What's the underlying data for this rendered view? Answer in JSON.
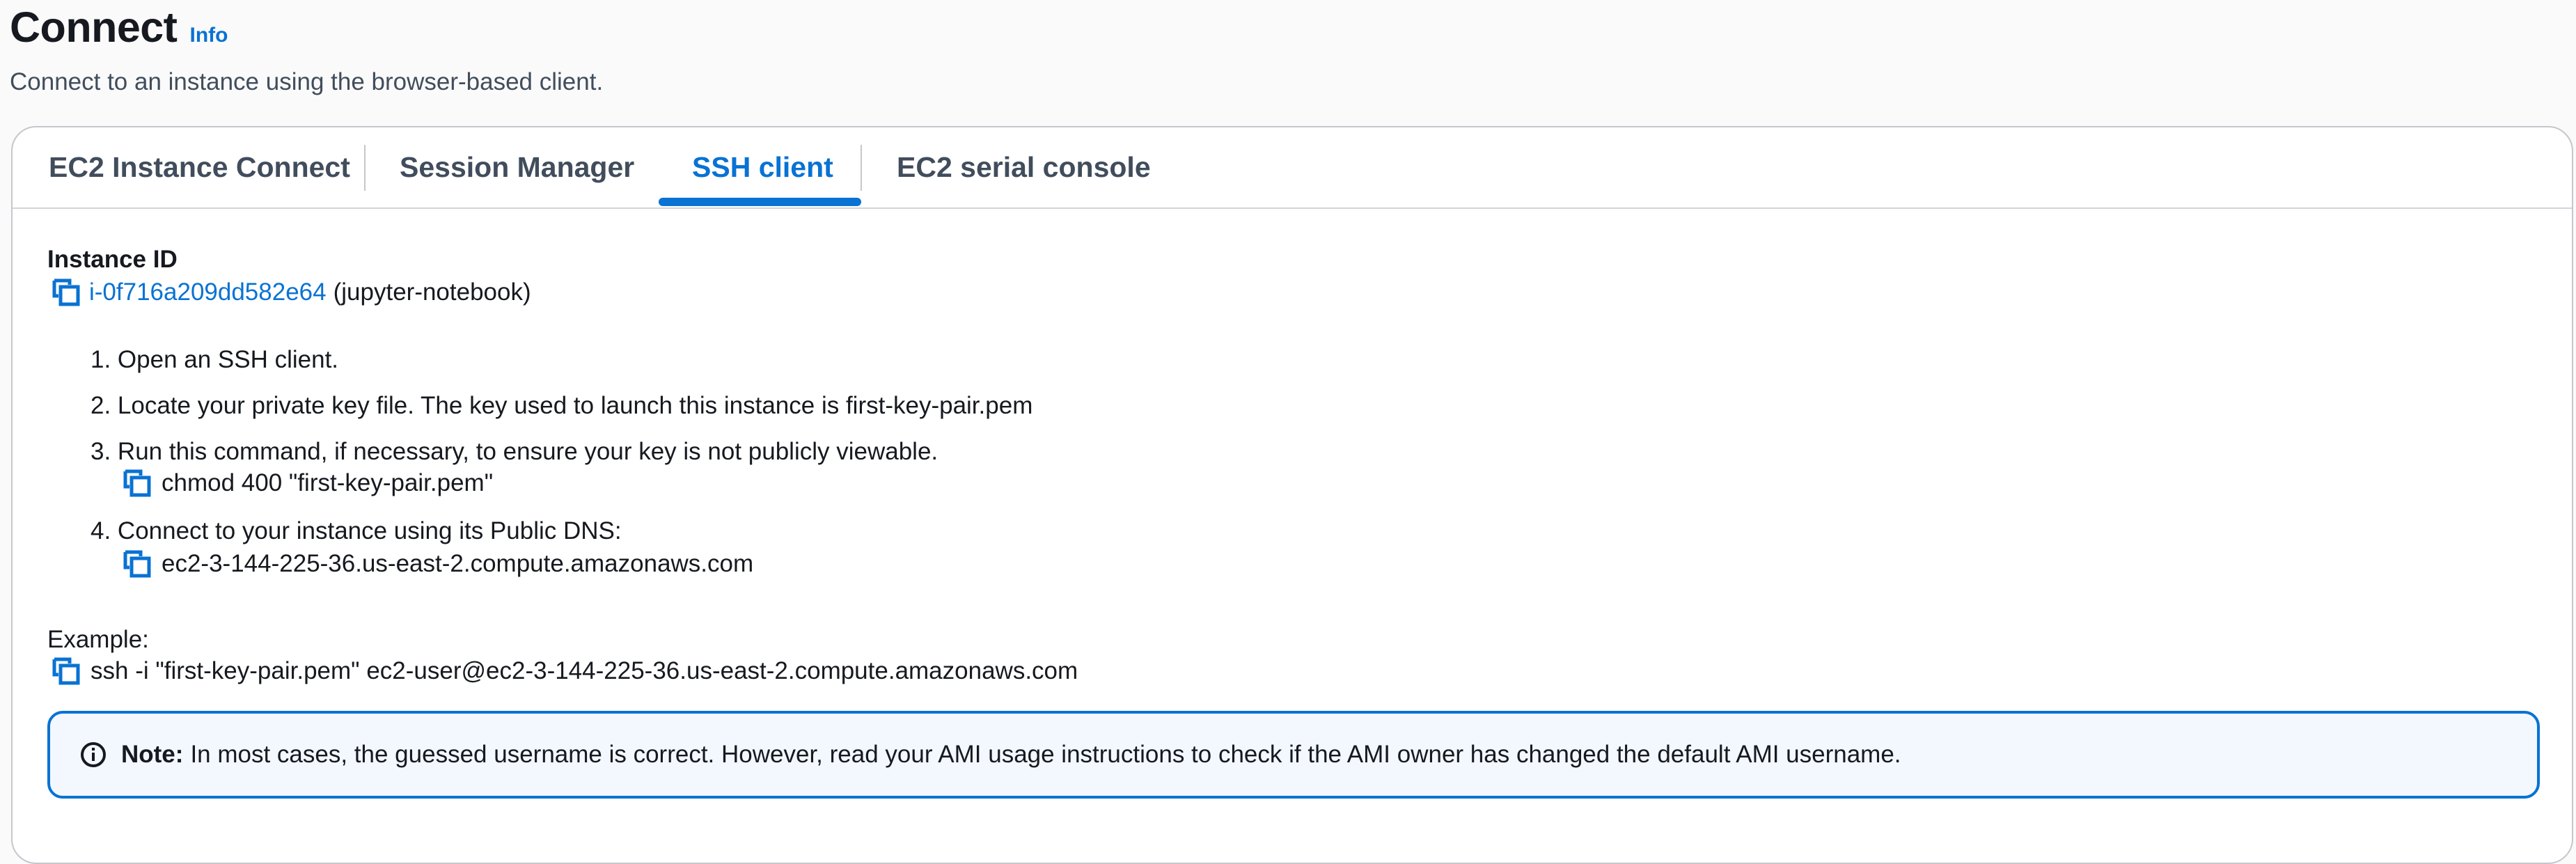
{
  "header": {
    "title": "Connect",
    "info_link": "Info",
    "subtitle": "Connect to an instance using the browser-based client."
  },
  "tabs": [
    {
      "label": "EC2 Instance Connect",
      "active": false
    },
    {
      "label": "Session Manager",
      "active": false
    },
    {
      "label": "SSH client",
      "active": true
    },
    {
      "label": "EC2 serial console",
      "active": false
    }
  ],
  "instance": {
    "label": "Instance ID",
    "id": "i-0f716a209dd582e64",
    "name": "(jupyter-notebook)"
  },
  "steps": [
    "1. Open an SSH client.",
    "2. Locate your private key file. The key used to launch this instance is first-key-pair.pem",
    "3. Run this command, if necessary, to ensure your key is not publicly viewable.",
    "4. Connect to your instance using its Public DNS:"
  ],
  "commands": {
    "chmod": "chmod 400 \"first-key-pair.pem\"",
    "public_dns": "ec2-3-144-225-36.us-east-2.compute.amazonaws.com"
  },
  "example": {
    "label": "Example:",
    "command": "ssh -i \"first-key-pair.pem\" ec2-user@ec2-3-144-225-36.us-east-2.compute.amazonaws.com"
  },
  "alert": {
    "title": "Note:",
    "text": "In most cases, the guessed username is correct. However, read your AMI usage instructions to check if the AMI owner has changed the default AMI username."
  },
  "colors": {
    "accent": "#0972d3",
    "alert_bg": "#f2f8fd"
  }
}
